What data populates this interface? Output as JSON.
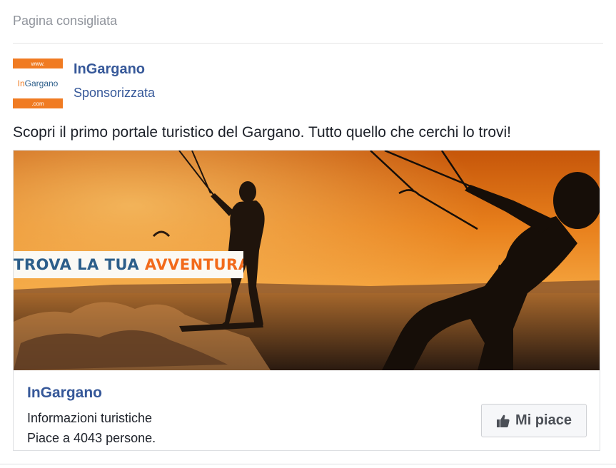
{
  "section_label": "Pagina consigliata",
  "page": {
    "name": "InGargano",
    "sponsored_label": "Sponsorizzata",
    "logo": {
      "top_text": "www.",
      "brand_prefix": "In",
      "brand_rest": "Gargano",
      "bottom_text": ".com"
    }
  },
  "post": {
    "text": "Scopri il primo portale turistico del Gargano. Tutto quello che cerchi lo trovi!"
  },
  "ad": {
    "banner_part1": "TROVA LA TUA",
    "banner_part2": "AVVENTURA",
    "card_title": "InGargano",
    "category": "Informazioni turistiche",
    "likes_text": "Piace a 4043 persone.",
    "like_button_label": "Mi piace",
    "like_icon": "thumbs-up-icon"
  },
  "colors": {
    "link_blue": "#365899",
    "muted_gray": "#90949c",
    "brand_orange": "#f26a1b",
    "banner_blue": "#2c5e8a"
  }
}
